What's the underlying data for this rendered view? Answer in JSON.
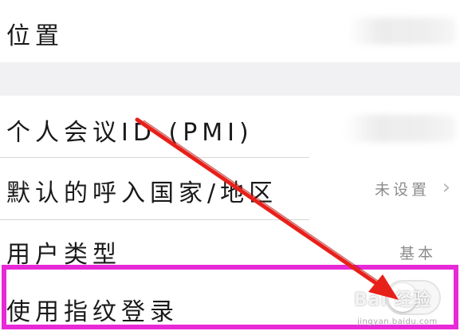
{
  "settings": {
    "location": {
      "label": "位置"
    },
    "pmi": {
      "label": "个人会议ID (PMI)"
    },
    "country": {
      "label": "默认的呼入国家/地区",
      "value": "未设置",
      "chevron": "›"
    },
    "user_type": {
      "label": "用户类型",
      "value": "基本"
    },
    "fingerprint_login": {
      "label": "使用指纹登录",
      "toggle_on": false
    }
  },
  "annotation": {
    "highlight_color": "#e829d8",
    "arrow_color": "#e8201a"
  },
  "watermark": {
    "logo": "Bai 经验",
    "url": "jingyan.baidu.com"
  }
}
